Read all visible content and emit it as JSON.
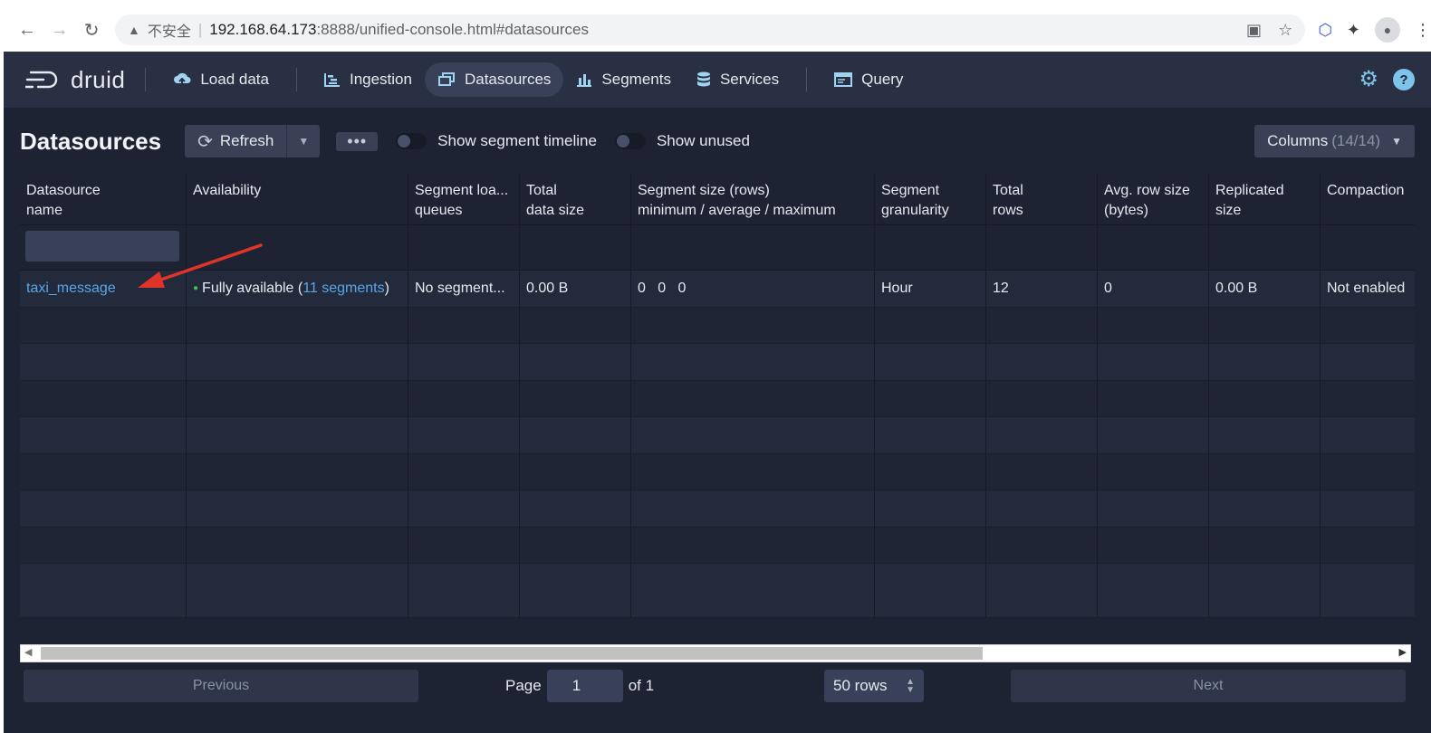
{
  "browser": {
    "insecure_label": "不安全",
    "url_host": "192.168.64.173",
    "url_rest": ":8888/unified-console.html#datasources"
  },
  "app": {
    "logo_text": "druid",
    "nav": {
      "load_data": "Load data",
      "ingestion": "Ingestion",
      "datasources": "Datasources",
      "segments": "Segments",
      "services": "Services",
      "query": "Query"
    },
    "help_glyph": "?"
  },
  "page": {
    "title": "Datasources",
    "refresh_label": "Refresh",
    "more_glyph": "•••",
    "toggle_timeline": "Show segment timeline",
    "toggle_unused": "Show unused",
    "columns_label": "Columns",
    "columns_count": "(14/14)"
  },
  "table": {
    "headers": {
      "h0a": "Datasource",
      "h0b": "name",
      "h1": "Availability",
      "h2a": "Segment loa...",
      "h2b": "queues",
      "h3a": "Total",
      "h3b": "data size",
      "h4a": "Segment size (rows)",
      "h4b": "minimum / average / maximum",
      "h5a": "Segment",
      "h5b": "granularity",
      "h6a": "Total",
      "h6b": "rows",
      "h7a": "Avg. row size",
      "h7b": "(bytes)",
      "h8a": "Replicated",
      "h8b": "size",
      "h9": "Compaction"
    },
    "row": {
      "name": "taxi_message",
      "availability_prefix": "Fully available (",
      "availability_link": "11 segments",
      "availability_suffix": ")",
      "load_queues": "No segment...",
      "total_size": "0.00 B",
      "seg_min": "0",
      "seg_avg": "0",
      "seg_max": "0",
      "granularity": "Hour",
      "total_rows": "12",
      "avg_row_size": "0",
      "replicated_size": "0.00 B",
      "compaction": "Not enabled"
    }
  },
  "pager": {
    "previous": "Previous",
    "page_label": "Page",
    "page_value": "1",
    "of_label": "of 1",
    "rows_label": "50 rows",
    "next": "Next"
  },
  "colors": {
    "app_bg": "#1d2333",
    "nav_bg": "#2a3043",
    "link": "#58a6e7",
    "accent_icon": "#7ec3ea",
    "status_green": "#3fbf55",
    "annotation_arrow": "#e0342b"
  }
}
